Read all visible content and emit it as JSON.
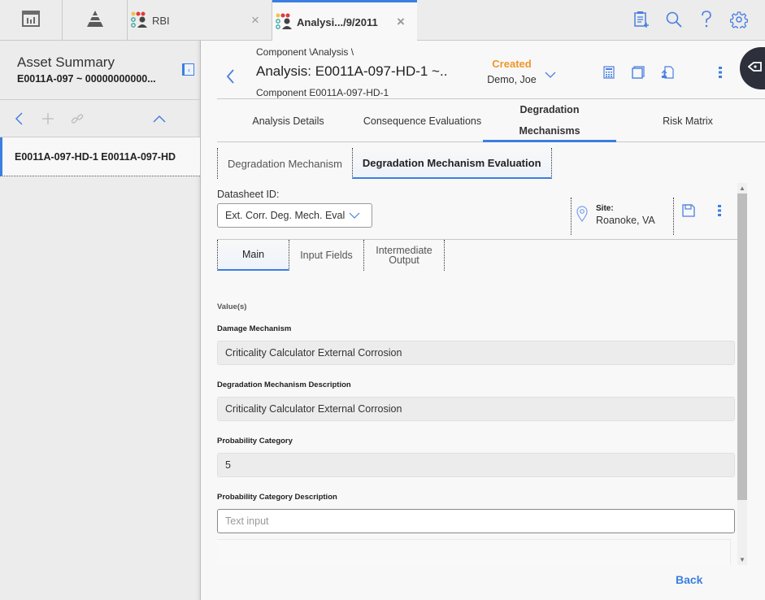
{
  "topbar": {
    "tabs": [
      {
        "label": "RBI",
        "icon": "rbi-app-icon",
        "close": "×"
      },
      {
        "label": "Analysi.../9/2011",
        "icon": "rbi-app-icon",
        "close": "×",
        "active": true
      }
    ],
    "left_icons": [
      "dashboard-icon",
      "hierarchy-pyramid-icon"
    ],
    "right_icons": [
      "new-report-icon",
      "search-icon",
      "help-icon",
      "settings-gear-icon"
    ]
  },
  "left_panel": {
    "title": "Asset Summary",
    "subtitle": "E0011A-097 ~ 00000000000...",
    "collapse_glyph": "‹",
    "tools": [
      "back-chevron-icon",
      "add-icon",
      "link-icon",
      "collapse-up-icon"
    ],
    "items": [
      {
        "label": "E0011A-097-HD-1 E0011A-097-HD",
        "selected": true
      }
    ]
  },
  "header": {
    "breadcrumb": "Component \\Analysis \\",
    "title": "Analysis: E0011A-097-HD-1 ~..",
    "subtitle": "Component E0011A-097-HD-1",
    "status": "Created",
    "user": "Demo, Joe",
    "status_color": "#f0962a",
    "action_icons": [
      "calculator-icon",
      "copy-window-icon",
      "import-export-icon",
      "more-vertical-icon"
    ]
  },
  "main_tabs": [
    {
      "label": "Analysis Details"
    },
    {
      "label": "Consequence Evaluations"
    },
    {
      "label": "Degradation Mechanisms",
      "active": true
    },
    {
      "label": "Risk Matrix"
    }
  ],
  "sub_tabs": [
    {
      "label": "Degradation Mechanism"
    },
    {
      "label": "Degradation Mechanism Evaluation",
      "active": true
    }
  ],
  "datasheet": {
    "label": "Datasheet ID:",
    "selected": "Ext. Corr. Deg. Mech. Eval",
    "site_label": "Site:",
    "site_value": "Roanoke, VA"
  },
  "section_tabs": [
    {
      "label": "Main",
      "active": true
    },
    {
      "label": "Input Fields"
    },
    {
      "label": "Intermediate Output"
    }
  ],
  "form": {
    "section_label": "Value(s)",
    "fields": [
      {
        "label": "Damage Mechanism",
        "value": "Criticality Calculator External Corrosion",
        "readonly": true
      },
      {
        "label": "Degradation Mechanism Description",
        "value": "Criticality Calculator External Corrosion",
        "readonly": true
      },
      {
        "label": "Probability Category",
        "value": "5",
        "readonly": true
      },
      {
        "label": "Probability Category Description",
        "value": "",
        "placeholder": "Text input",
        "readonly": false
      }
    ]
  },
  "footer": {
    "back_label": "Back"
  },
  "colors": {
    "accent": "#3b7fe0",
    "status_created": "#f0962a",
    "fab": "#2d2f3b"
  }
}
